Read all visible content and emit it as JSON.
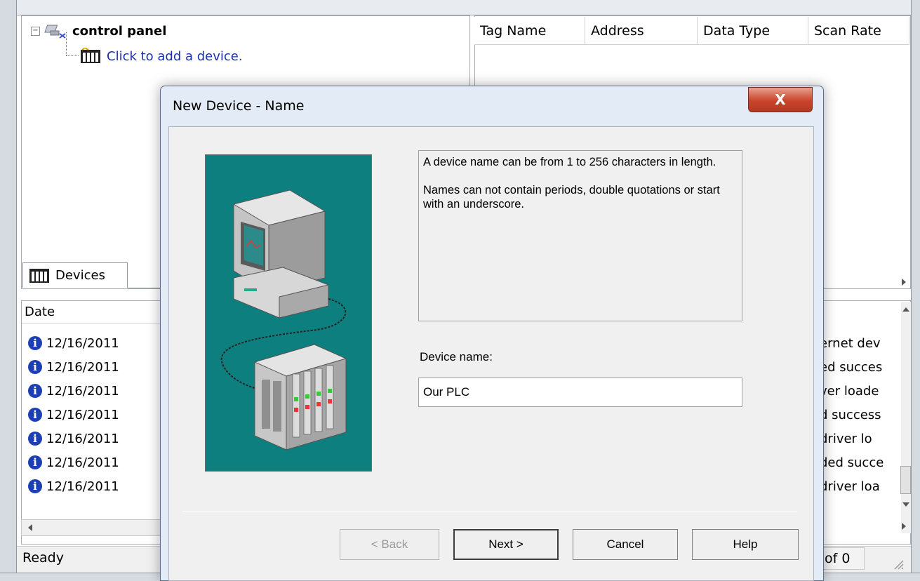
{
  "tree": {
    "root_label": "control panel",
    "child_label": "Click to add a device."
  },
  "tabs": {
    "devices": "Devices"
  },
  "tag_table": {
    "columns": [
      "Tag Name",
      "Address",
      "Data Type",
      "Scan Rate"
    ]
  },
  "log": {
    "header_date": "Date",
    "rows": [
      {
        "date": "12/16/2011",
        "trail": "ernet dev"
      },
      {
        "date": "12/16/2011",
        "trail": "ed succes"
      },
      {
        "date": "12/16/2011",
        "trail": "ver loade"
      },
      {
        "date": "12/16/2011",
        "trail": "d success"
      },
      {
        "date": "12/16/2011",
        "trail": "driver lo"
      },
      {
        "date": "12/16/2011",
        "trail": "ded succe"
      },
      {
        "date": "12/16/2011",
        "trail": "driver loa"
      }
    ]
  },
  "status": {
    "text": "Ready",
    "right": "of 0"
  },
  "dialog": {
    "title": "New Device - Name",
    "close_glyph": "X",
    "description_p1": "A device name can be from 1 to 256 characters in length.",
    "description_p2": "Names can not contain periods, double quotations or start with an underscore.",
    "name_label": "Device name:",
    "name_value": "Our PLC",
    "buttons": {
      "back": "< Back",
      "next": "Next >",
      "cancel": "Cancel",
      "help": "Help"
    }
  },
  "colors": {
    "illustration_bg": "#0e7f7f",
    "close_button": "#c9442b",
    "link_text": "#1a30b0",
    "info_icon": "#1d3fb5"
  },
  "icons": [
    "device-tree-icon",
    "device-rack-icon",
    "info-icon",
    "close-icon",
    "computer-illustration",
    "plc-illustration"
  ]
}
